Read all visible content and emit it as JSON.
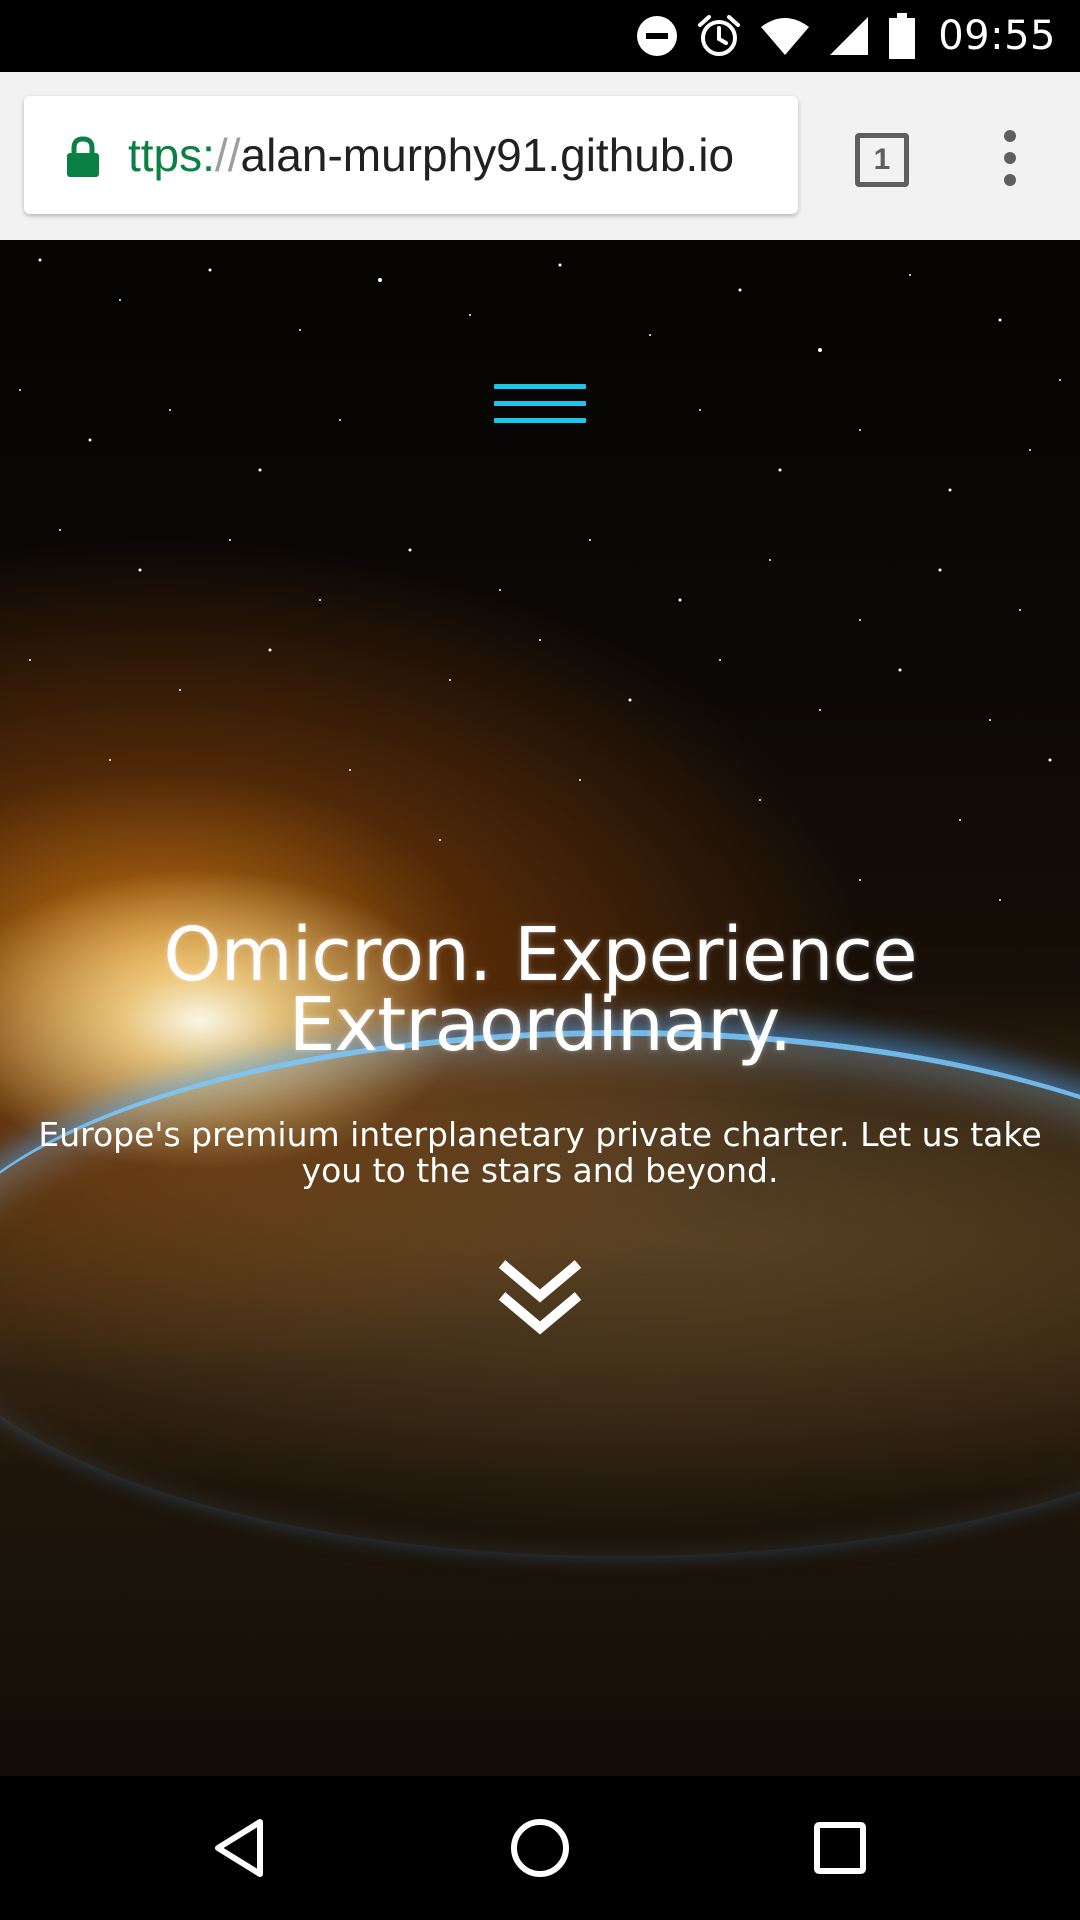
{
  "status_bar": {
    "time": "09:55",
    "icons": [
      "do-not-disturb-icon",
      "alarm-icon",
      "wifi-icon",
      "cell-signal-icon",
      "battery-icon"
    ]
  },
  "browser": {
    "url_scheme": "ttps:",
    "url_sep": "//",
    "url_host": "alan-murphy91.github.io",
    "tab_count": "1",
    "colors": {
      "secure_green": "#0b8043",
      "toolbar_bg": "#f2f2f2"
    }
  },
  "hero": {
    "title": "Omicron. Experience Extraordinary.",
    "subtitle": "Europe's premium interplanetary private charter. Let us take you to the stars and beyond.",
    "menu_icon": "hamburger-menu-icon",
    "scroll_icon": "double-chevron-down-icon",
    "colors": {
      "menu_accent": "#1ec5e8",
      "text": "#ffffff"
    }
  },
  "nav_bar": {
    "buttons": [
      "back-icon",
      "home-icon",
      "recents-icon"
    ]
  }
}
